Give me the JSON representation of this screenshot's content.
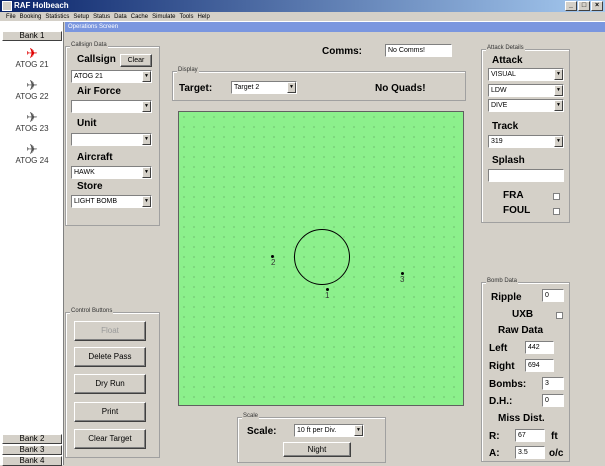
{
  "window": {
    "title": "RAF Holbeach"
  },
  "menu": [
    "File",
    "Booking",
    "Statistics",
    "Setup",
    "Status",
    "Data",
    "Cache",
    "Simulate",
    "Tools",
    "Help"
  ],
  "ops_title": "Operations Screen",
  "banks": {
    "top": "Bank 1",
    "b2": "Bank 2",
    "b3": "Bank 3",
    "b4": "Bank 4"
  },
  "aircraft": [
    {
      "label": "ATOG 21",
      "active": true
    },
    {
      "label": "ATOG 22"
    },
    {
      "label": "ATOG 23"
    },
    {
      "label": "ATOG 24"
    }
  ],
  "callsign": {
    "group": "Callsign Data",
    "label": "Callsign",
    "clear": "Clear",
    "value": "ATOG 21",
    "af_label": "Air Force",
    "af_value": "",
    "unit_label": "Unit",
    "unit_value": "",
    "aircraft_label": "Aircraft",
    "aircraft_value": "HAWK",
    "store_label": "Store",
    "store_value": "LIGHT BOMB"
  },
  "comms": {
    "label": "Comms:",
    "value": "No Comms!"
  },
  "display": {
    "group": "Display",
    "target_label": "Target:",
    "target_value": "Target 2",
    "quads": "No Quads!"
  },
  "targets": [
    {
      "label": "1"
    },
    {
      "label": "2"
    },
    {
      "label": "3"
    }
  ],
  "control": {
    "group": "Control Buttons",
    "float": "Float",
    "delete": "Delete Pass",
    "dryrun": "Dry Run",
    "print": "Print",
    "clear": "Clear Target"
  },
  "scale": {
    "group": "Scale",
    "label": "Scale:",
    "value": "10 ft per Div.",
    "night": "Night"
  },
  "attack": {
    "group": "Attack Details",
    "label": "Attack",
    "v1": "VISUAL",
    "v2": "LDW",
    "v3": "DIVE",
    "track_label": "Track",
    "track_value": "319",
    "splash_label": "Splash",
    "splash_value": "",
    "fra": "FRA",
    "foul": "FOUL"
  },
  "bomb": {
    "group": "Bomb Data",
    "ripple_label": "Ripple",
    "ripple": "0",
    "uxb": "UXB",
    "raw": "Raw Data",
    "left_label": "Left",
    "left": "442",
    "right_label": "Right",
    "right": "694",
    "bombs_label": "Bombs:",
    "bombs": "3",
    "dh_label": "D.H.:",
    "dh": "0",
    "miss": "Miss Dist.",
    "r_label": "R:",
    "r": "67",
    "r_unit": "ft",
    "a_label": "A:",
    "a": "3.5",
    "a_unit": "o/c"
  }
}
